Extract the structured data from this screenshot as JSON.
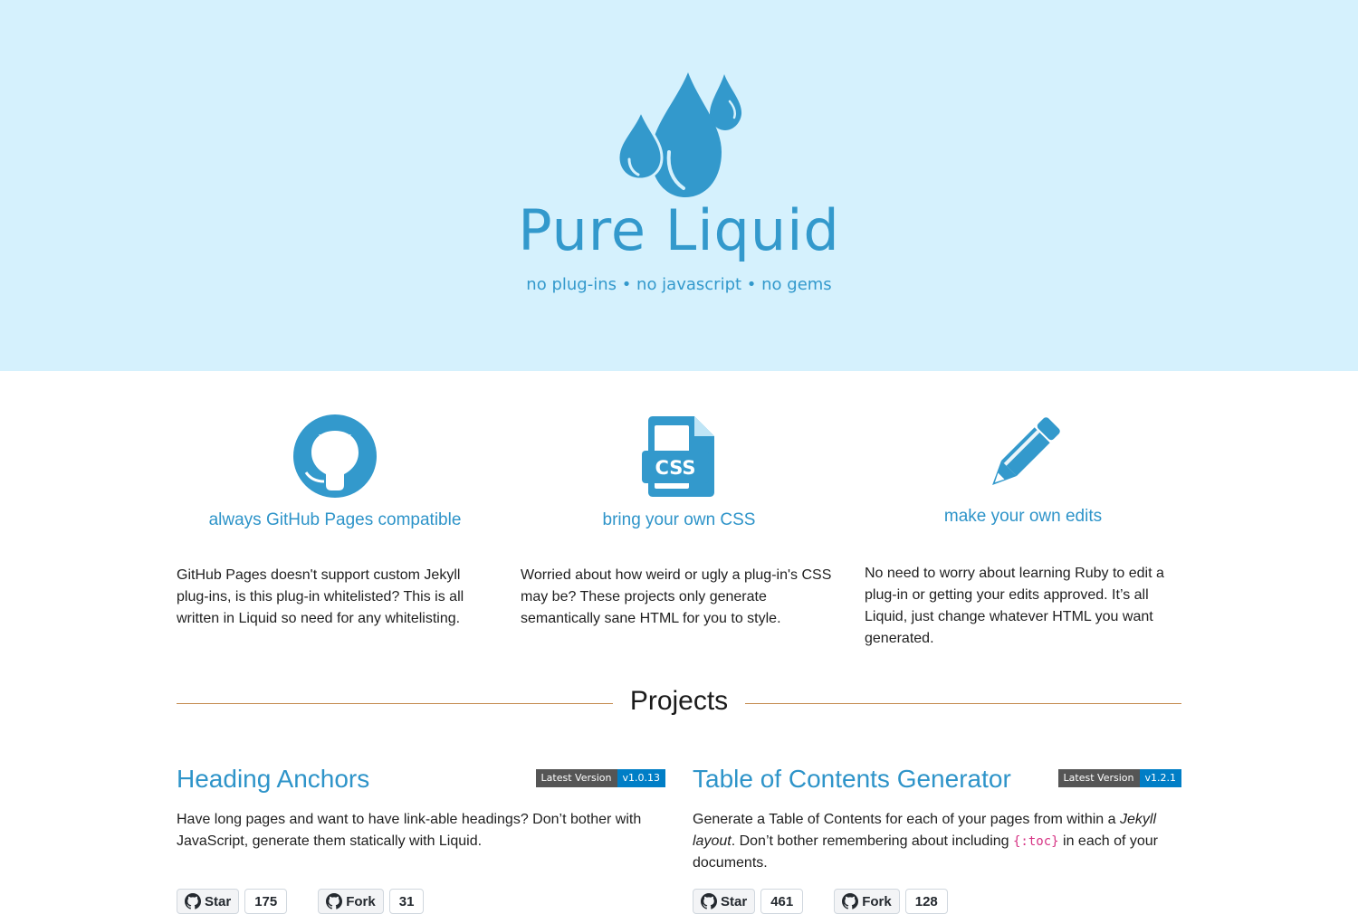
{
  "hero": {
    "title": "Pure Liquid",
    "subtitle": "no plug-ins • no javascript • no gems",
    "background": "#d5f1fd",
    "accent": "#3399cc"
  },
  "features": [
    {
      "icon": "github-icon",
      "title": "always GitHub Pages compatible",
      "body": "GitHub Pages doesn't support custom Jekyll plug-ins, is this plug-in whitelisted? This is all written in Liquid so need for any whitelisting."
    },
    {
      "icon": "css-file-icon",
      "icon_label": "CSS",
      "title": "bring your own CSS",
      "body": "Worried about how weird or ugly a plug-in's CSS may be? These projects only generate semantically sane HTML for you to style."
    },
    {
      "icon": "pencil-icon",
      "title": "make your own edits",
      "body": "No need to worry about learning Ruby to edit a plug-in or getting your edits approved. It’s all Liquid, just change whatever HTML you want generated."
    }
  ],
  "projects_heading": "Projects",
  "projects": [
    {
      "title": "Heading Anchors",
      "badge_label": "Latest Version",
      "badge_value": "v1.0.13",
      "description": "Have long pages and want to have link-able headings? Don’t bother with JavaScript, generate them statically with Liquid.",
      "star_label": "Star",
      "star_count": "175",
      "fork_label": "Fork",
      "fork_count": "31"
    },
    {
      "title": "Table of Contents Generator",
      "badge_label": "Latest Version",
      "badge_value": "v1.2.1",
      "description_part1": "Generate a Table of Contents for each of your pages from within a ",
      "description_em": "Jekyll layout",
      "description_part2": ". Don’t bother remembering about including ",
      "description_code": "{:toc}",
      "description_part3": " in each of your documents.",
      "star_label": "Star",
      "star_count": "461",
      "fork_label": "Fork",
      "fork_count": "128"
    }
  ],
  "colors": {
    "link": "#2e94c9",
    "divider": "#c48a4e",
    "badge_key": "#555555",
    "badge_value": "#007ec6"
  }
}
